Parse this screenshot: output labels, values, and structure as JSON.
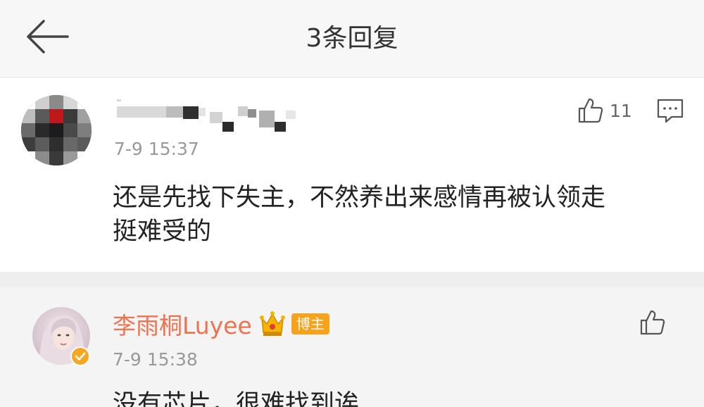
{
  "header": {
    "title": "3条回复",
    "back_icon": "back-arrow-icon"
  },
  "comment": {
    "time": "7-9 15:37",
    "text_line1": "还是先找下失主，不然养出来感情再被认领走",
    "text_line2": "挺难受的",
    "like_count": "11",
    "like_icon": "thumbs-up-icon",
    "reply_icon": "comment-icon"
  },
  "reply": {
    "username": "李雨桐Luyee",
    "badge": "博主",
    "time": "7-9 15:38",
    "text": "没有芯片，很难找到诶",
    "crown_icon": "crown-icon",
    "verified_icon": "verified-badge-icon",
    "like_icon": "thumbs-up-icon"
  },
  "colors": {
    "username_accent": "#eb7350",
    "badge_bg": "#f7a21b",
    "header_bg": "#f7f7f7",
    "reply_bg": "#f4f4f4"
  }
}
